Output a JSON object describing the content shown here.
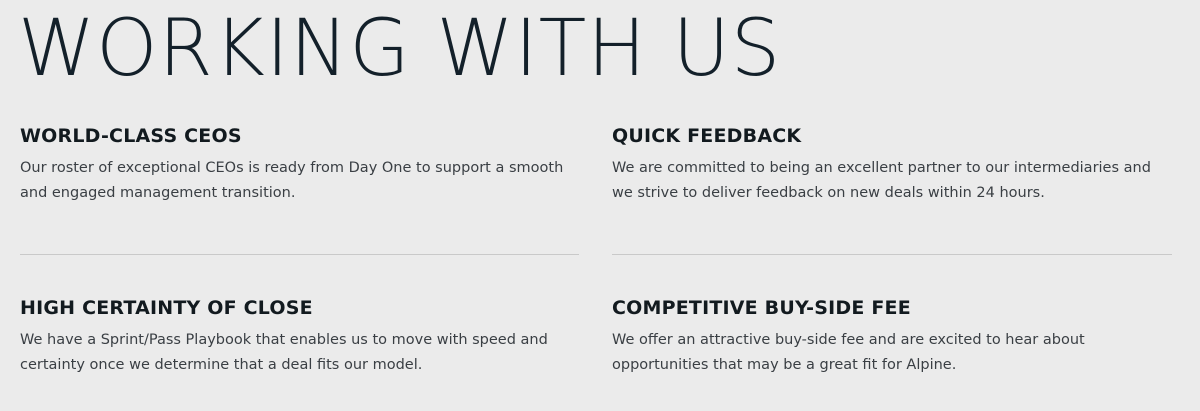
{
  "page_title": "WORKING WITH US",
  "features": [
    {
      "title": "WORLD-CLASS CEOS",
      "description": "Our roster of exceptional CEOs is ready from Day One to support a smooth and engaged management transition."
    },
    {
      "title": "QUICK FEEDBACK",
      "description": "We are committed to being an excellent partner to our intermediaries and we strive to deliver feedback on new deals within 24 hours."
    },
    {
      "title": "HIGH CERTAINTY OF CLOSE",
      "description": "We have a Sprint/Pass Playbook that enables us to move with speed and certainty once we determine that a deal fits our model."
    },
    {
      "title": "COMPETITIVE BUY-SIDE FEE",
      "description": "We offer an attractive buy-side fee and are excited to hear about opportunities that may be a great fit for Alpine."
    }
  ]
}
